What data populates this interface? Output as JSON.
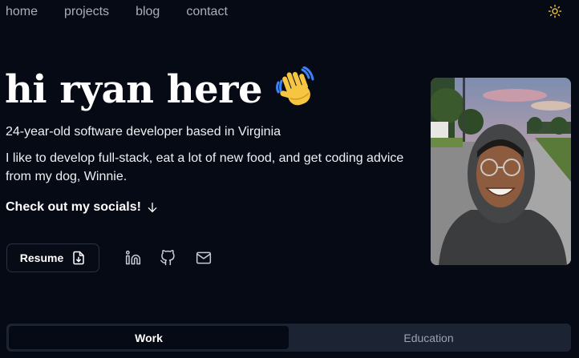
{
  "nav": {
    "items": [
      {
        "label": "home"
      },
      {
        "label": "projects"
      },
      {
        "label": "blog"
      },
      {
        "label": "contact"
      }
    ],
    "theme_icon": "sun-icon"
  },
  "hero": {
    "title": "hi ryan here",
    "emoji_icon": "waving-hand-icon",
    "subtitle": "24-year-old software developer based in Virginia",
    "bio": "I like to develop full-stack, eat a lot of new food, and get coding advice from my dog, Winnie.",
    "socials_cta": "Check out my socials!",
    "socials_cta_icon": "arrow-down-icon"
  },
  "actions": {
    "resume_label": "Resume",
    "resume_icon": "file-download-icon",
    "social_icons": [
      "linkedin-icon",
      "github-icon",
      "mail-icon"
    ]
  },
  "tabs": [
    {
      "label": "Work",
      "active": true
    },
    {
      "label": "Education",
      "active": false
    }
  ],
  "colors": {
    "background": "#060a14",
    "text": "#f2f4f8",
    "muted": "#a9aeb8",
    "tab_track": "#1c2434",
    "sun": "#e8b83a"
  }
}
